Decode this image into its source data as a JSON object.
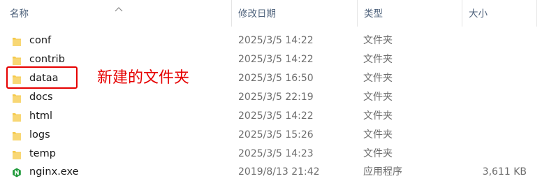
{
  "columns": {
    "name": "名称",
    "modified": "修改日期",
    "type": "类型",
    "size": "大小"
  },
  "files": [
    {
      "name": "conf",
      "modified": "2025/3/5 14:22",
      "type": "文件夹",
      "size": "",
      "icon": "folder-icon"
    },
    {
      "name": "contrib",
      "modified": "2025/3/5 14:22",
      "type": "文件夹",
      "size": "",
      "icon": "folder-icon"
    },
    {
      "name": "dataa",
      "modified": "2025/3/5 16:50",
      "type": "文件夹",
      "size": "",
      "icon": "folder-icon"
    },
    {
      "name": "docs",
      "modified": "2025/3/5 22:19",
      "type": "文件夹",
      "size": "",
      "icon": "folder-icon"
    },
    {
      "name": "html",
      "modified": "2025/3/5 14:22",
      "type": "文件夹",
      "size": "",
      "icon": "folder-icon"
    },
    {
      "name": "logs",
      "modified": "2025/3/5 15:26",
      "type": "文件夹",
      "size": "",
      "icon": "folder-icon"
    },
    {
      "name": "temp",
      "modified": "2025/3/5 14:23",
      "type": "文件夹",
      "size": "",
      "icon": "folder-icon"
    },
    {
      "name": "nginx.exe",
      "modified": "2019/8/13 21:42",
      "type": "应用程序",
      "size": "3,611 KB",
      "icon": "nginx-app-icon"
    }
  ],
  "annotation": {
    "text": "新建的文件夹",
    "color": "#e60000"
  },
  "colors": {
    "folder": "#f5c94a",
    "nginx": "#1f9a3a"
  }
}
